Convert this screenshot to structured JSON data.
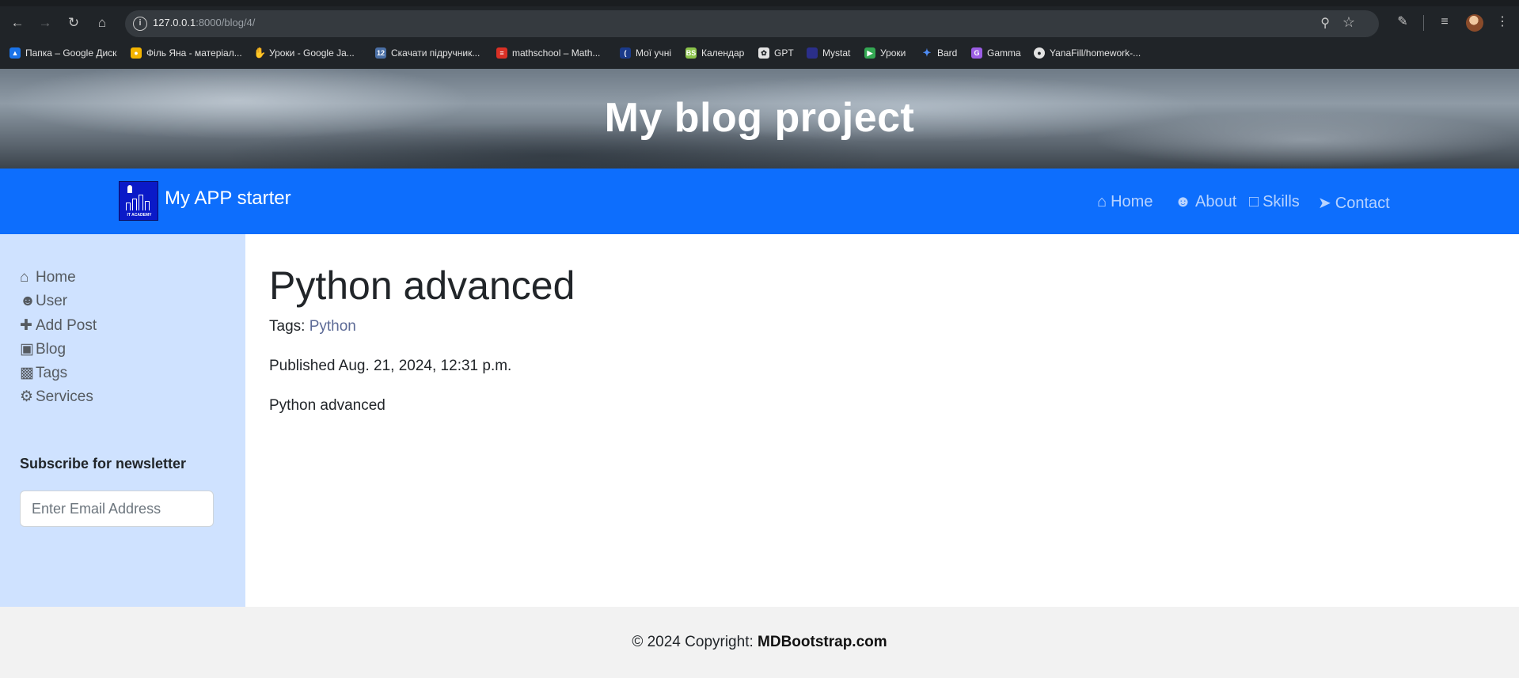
{
  "browser": {
    "url_host": "127.0.0.1",
    "url_rest": ":8000/blog/4/",
    "bookmarks": [
      {
        "label": "Папка – Google Диск",
        "icon": "google-drive-icon",
        "color": "#1a73e8"
      },
      {
        "label": "Філь Яна - матеріал...",
        "icon": "google-classroom-icon",
        "color": "#f4b400"
      },
      {
        "label": "Уроки - Google Ja...",
        "icon": "hand-icon",
        "color": "#f6c000"
      },
      {
        "label": "Скачати підручник...",
        "icon": "book-12-icon",
        "color": "#4a6fa5"
      },
      {
        "label": "mathschool – Math...",
        "icon": "mathschool-icon",
        "color": "#d93025"
      },
      {
        "label": "Мої учні",
        "icon": "students-icon",
        "color": "#1a3a8a"
      },
      {
        "label": "Календар",
        "icon": "calendar-icon",
        "color": "#8bc34a"
      },
      {
        "label": "GPT",
        "icon": "openai-icon",
        "color": "#e3e3e3"
      },
      {
        "label": "Mystat",
        "icon": "mystat-icon",
        "color": "#2b2f8a"
      },
      {
        "label": "Уроки",
        "icon": "meet-icon",
        "color": "#34a853"
      },
      {
        "label": "Bard",
        "icon": "sparkle-icon",
        "color": "#4f8df5"
      },
      {
        "label": "Gamma",
        "icon": "gamma-icon",
        "color": "#9b5de5"
      },
      {
        "label": "YanaFill/homework-...",
        "icon": "github-icon",
        "color": "#e3e3e3"
      }
    ]
  },
  "header": {
    "title": "My blog project"
  },
  "navbar": {
    "brand": "My APP starter",
    "logo_caption": "IT ACADEMY",
    "links": [
      {
        "label": "Home",
        "icon": "home-icon"
      },
      {
        "label": "About",
        "icon": "user-icon"
      },
      {
        "label": "Skills",
        "icon": "book-icon"
      },
      {
        "label": "Contact",
        "icon": "paper-plane-icon"
      }
    ],
    "color": "#0d6efd"
  },
  "sidebar": {
    "items": [
      {
        "label": "Home",
        "icon": "home-icon"
      },
      {
        "label": "User",
        "icon": "user-icon"
      },
      {
        "label": "Add Post",
        "icon": "plus-icon"
      },
      {
        "label": "Blog",
        "icon": "sticky-note-icon"
      },
      {
        "label": "Tags",
        "icon": "suitcase-icon"
      },
      {
        "label": "Services",
        "icon": "gears-icon"
      }
    ],
    "newsletter_title": "Subscribe for newsletter",
    "email_placeholder": "Enter Email Address",
    "color": "#cfe2ff"
  },
  "post": {
    "title": "Python advanced",
    "tags_label": "Tags:",
    "tag": "Python",
    "published": "Published Aug. 21, 2024, 12:31 p.m.",
    "body": "Python advanced"
  },
  "footer": {
    "copyright": "© 2024 Copyright:",
    "site": "MDBootstrap.com"
  }
}
